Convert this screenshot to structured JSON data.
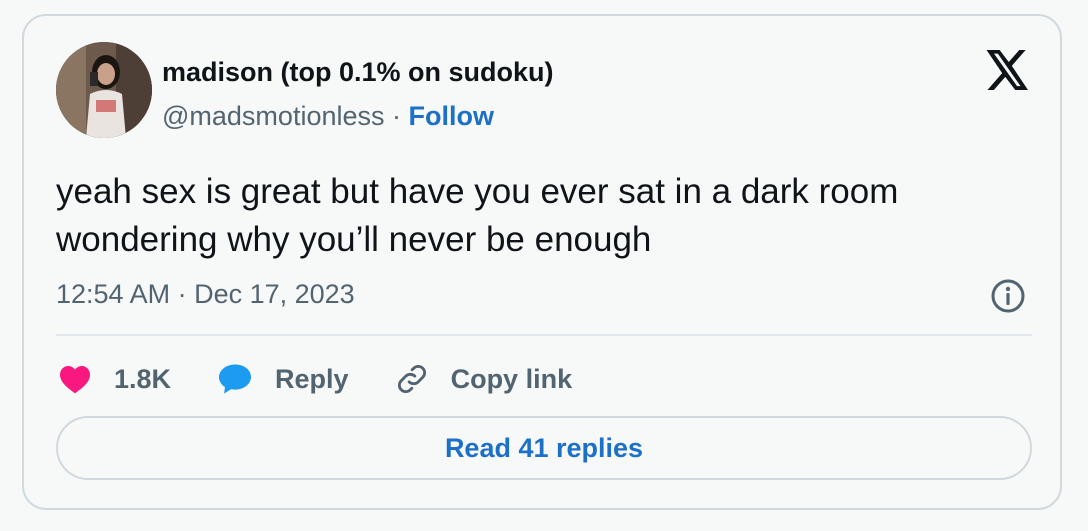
{
  "author": {
    "display_name": "madison (top 0.1% on sudoku)",
    "handle": "@madsmotionless",
    "separator": "·",
    "follow_label": "Follow"
  },
  "platform_icon": "x-logo-icon",
  "tweet": {
    "text": "yeah sex is great but have you ever sat in a dark room wondering why you’ll never be enough",
    "timestamp": "12:54 AM · Dec 17, 2023"
  },
  "actions": {
    "like_count": "1.8K",
    "reply_label": "Reply",
    "copy_link_label": "Copy link"
  },
  "read_replies_label": "Read 41 replies",
  "colors": {
    "accent": "#1d70c8",
    "like": "#f91880",
    "reply": "#1d9bf0",
    "muted": "#536471"
  }
}
